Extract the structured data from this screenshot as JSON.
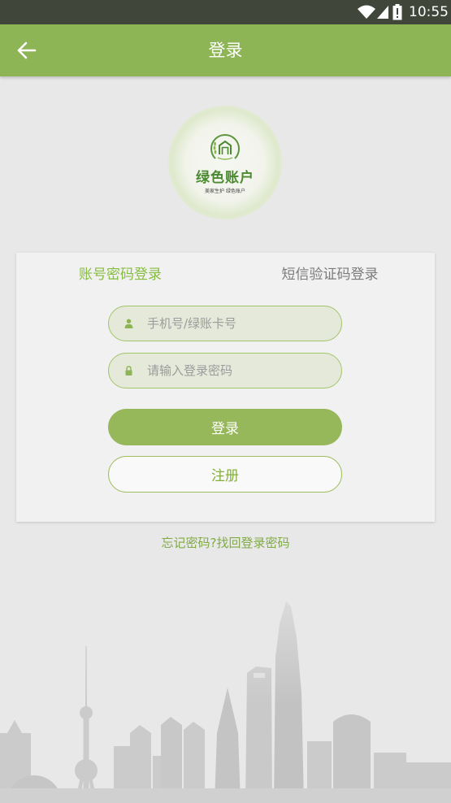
{
  "status_bar": {
    "time": "10:55",
    "icons": [
      "wifi-icon",
      "signal-icon",
      "battery-icon"
    ]
  },
  "header": {
    "back_icon": "arrow-left-icon",
    "title": "登录"
  },
  "logo": {
    "name": "绿色账户",
    "tagline": "美家生护 绿色账户"
  },
  "login_card": {
    "tabs": [
      {
        "label": "账号密码登录",
        "active": true
      },
      {
        "label": "短信验证码登录",
        "active": false
      }
    ],
    "fields": {
      "account": {
        "icon": "user-icon",
        "value": "",
        "placeholder": "手机号/绿账卡号"
      },
      "password": {
        "icon": "lock-icon",
        "value": "",
        "placeholder": "请输入登录密码"
      }
    },
    "login_button": "登录",
    "register_button": "注册"
  },
  "forgot_link": "忘记密码?找回登录密码",
  "colors": {
    "primary": "#8db455",
    "active_tab": "#86bd3f",
    "inactive_tab": "#7b7b7b",
    "link": "#80aa44",
    "background": "#e8e8e8"
  }
}
